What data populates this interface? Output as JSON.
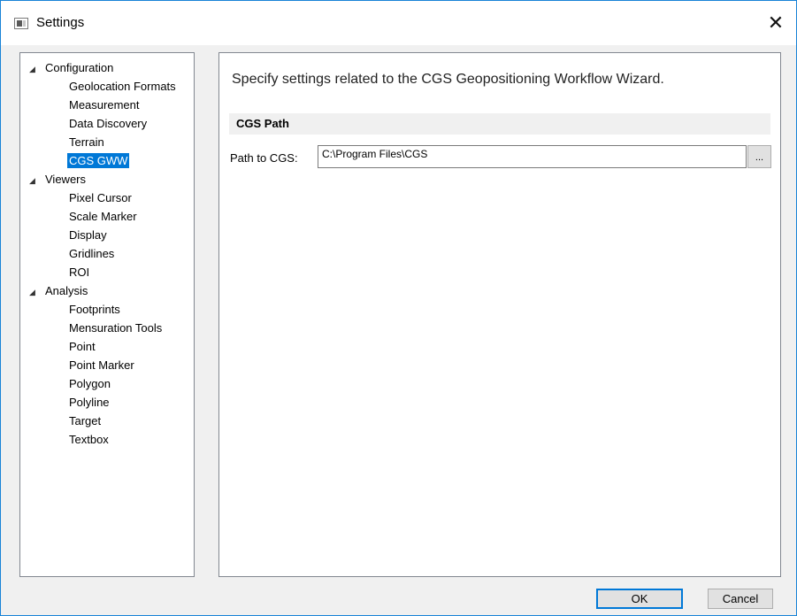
{
  "window": {
    "title": "Settings",
    "close_glyph": "✕"
  },
  "tree": {
    "groups": [
      {
        "label": "Configuration",
        "items": [
          "Geolocation Formats",
          "Measurement",
          "Data Discovery",
          "Terrain",
          "CGS GWW"
        ]
      },
      {
        "label": "Viewers",
        "items": [
          "Pixel Cursor",
          "Scale Marker",
          "Display",
          "Gridlines",
          "ROI"
        ]
      },
      {
        "label": "Analysis",
        "items": [
          "Footprints",
          "Mensuration Tools",
          "Point",
          "Point Marker",
          "Polygon",
          "Polyline",
          "Target",
          "Textbox"
        ]
      }
    ],
    "selected": "CGS GWW",
    "expand_glyph": "◢"
  },
  "content": {
    "description": "Specify settings related to the CGS Geopositioning Workflow Wizard.",
    "section_title": "CGS Path",
    "path_label": "Path to CGS:",
    "path_value": "C:\\Program Files\\CGS",
    "browse_label": "..."
  },
  "buttons": {
    "ok": "OK",
    "cancel": "Cancel"
  },
  "colors": {
    "selection": "#0078d7",
    "window_border": "#1883d7"
  }
}
